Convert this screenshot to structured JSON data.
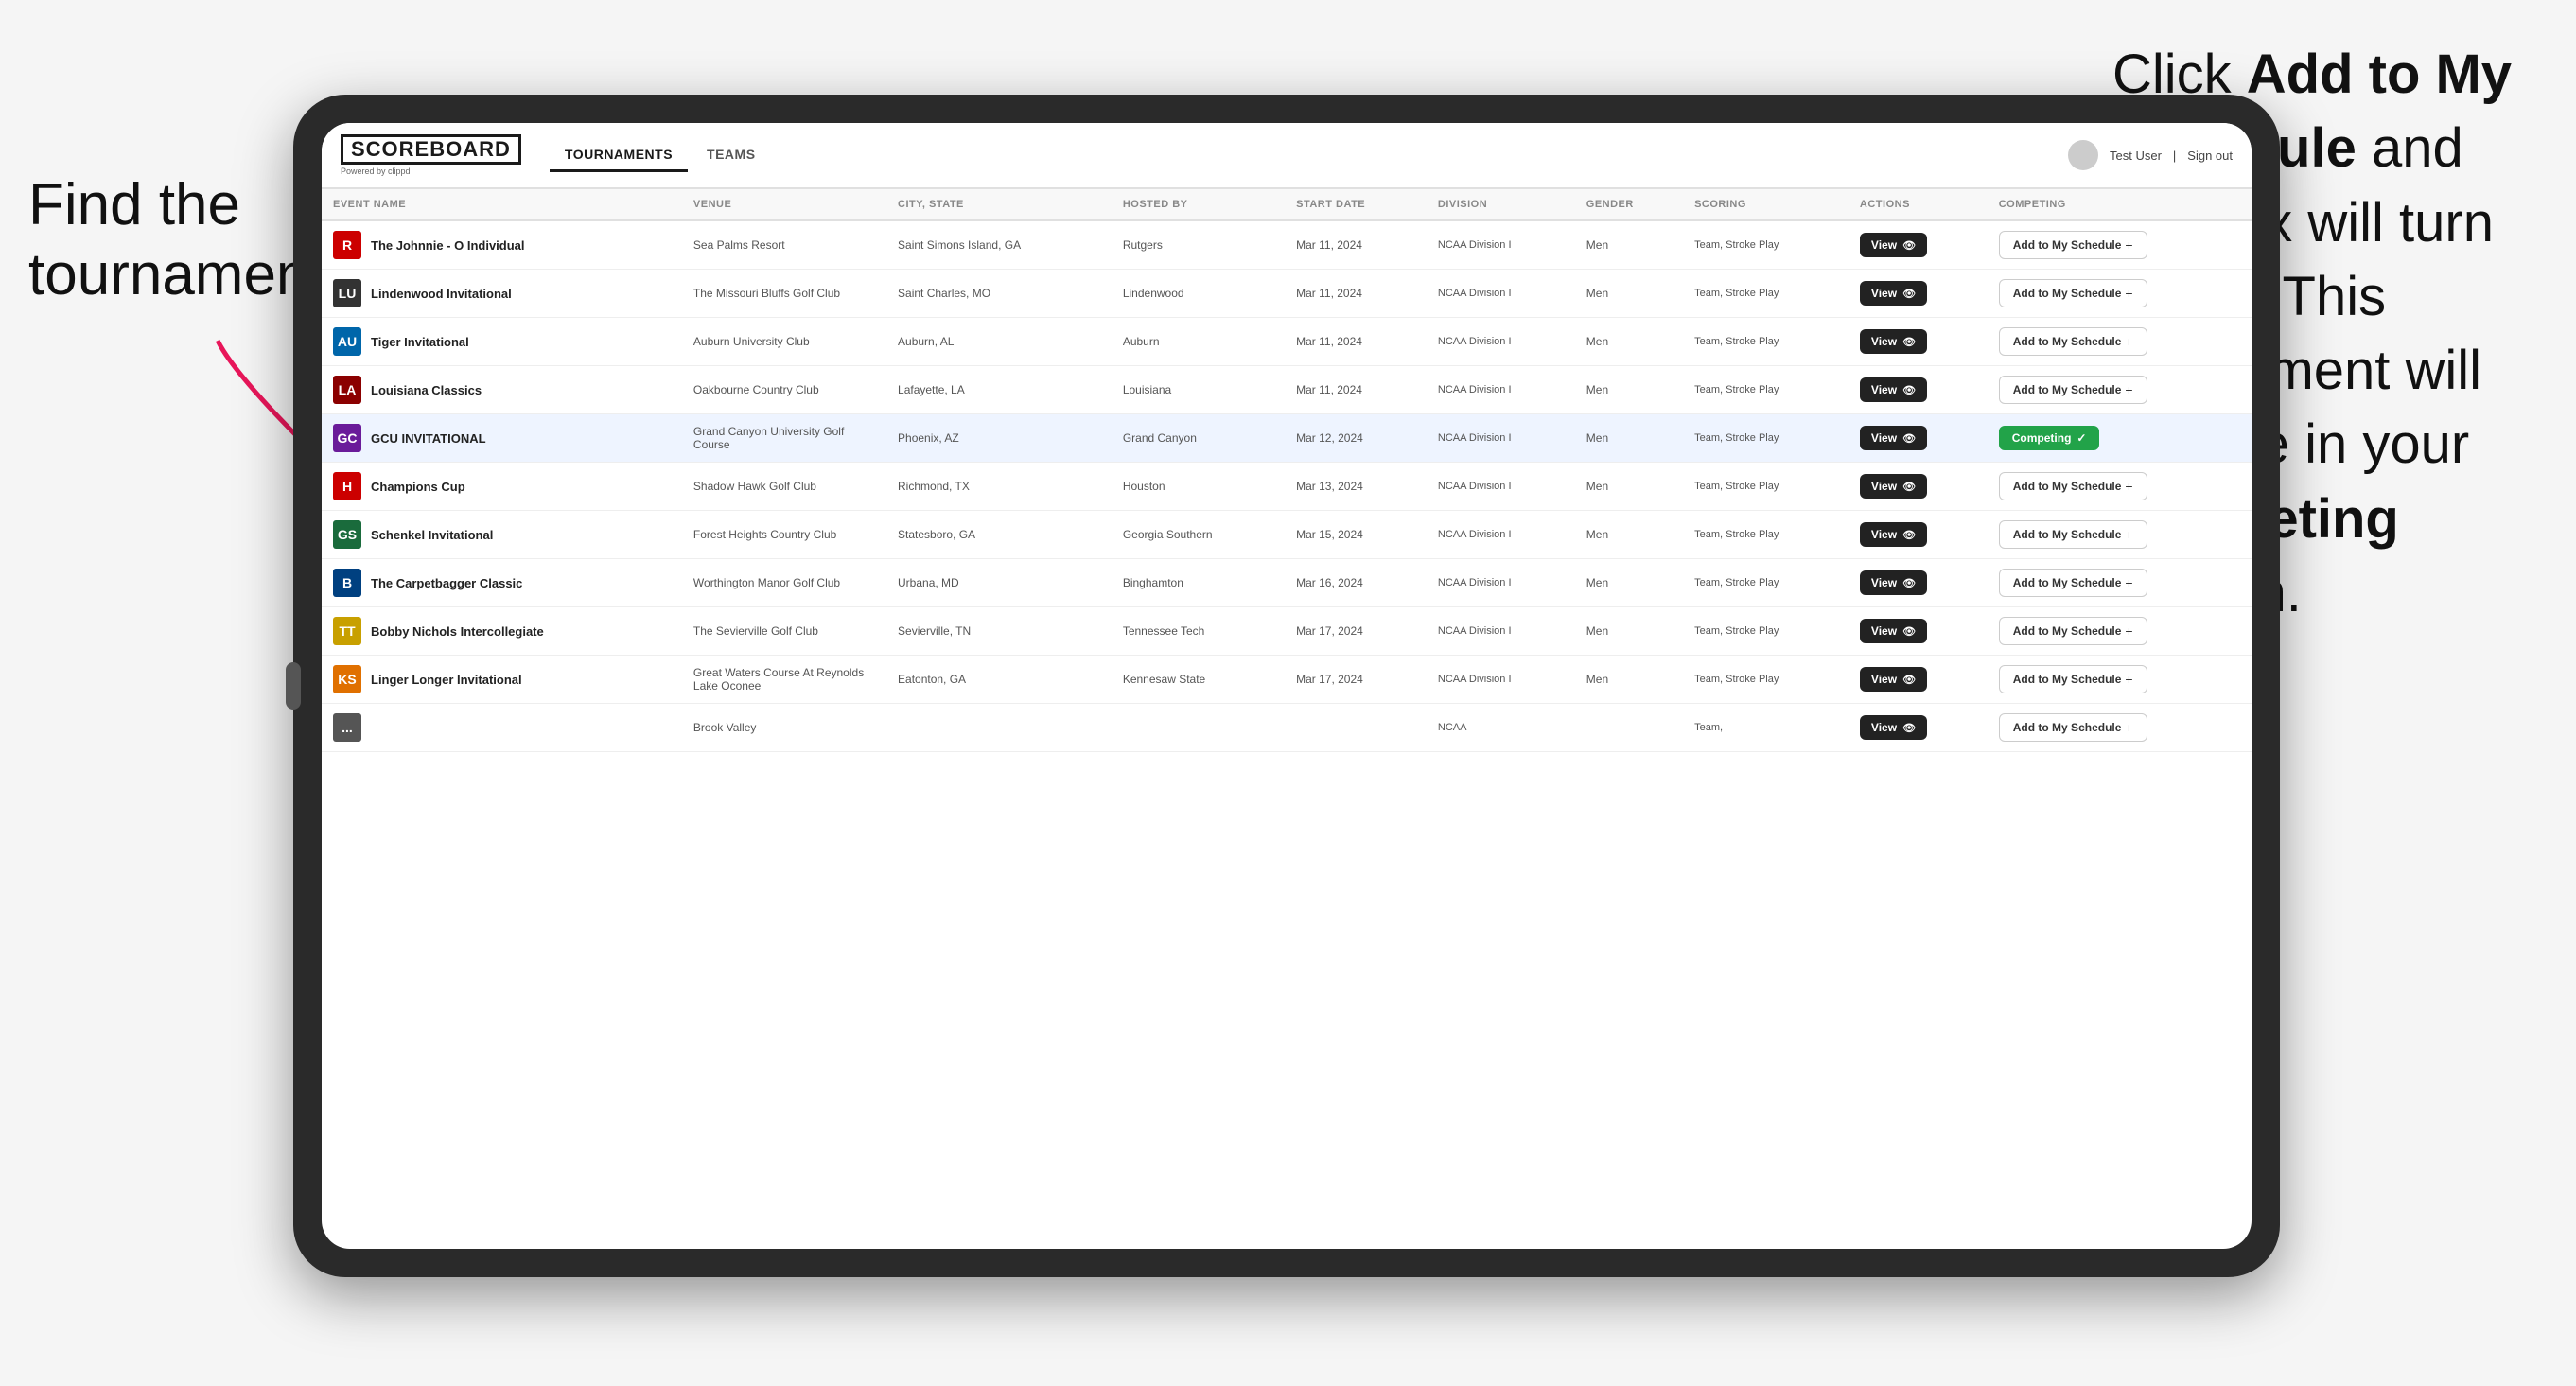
{
  "annotations": {
    "left": {
      "line1": "Find the",
      "line2": "tournament."
    },
    "right": {
      "text_pre": "Click ",
      "bold1": "Add to My Schedule",
      "text_mid": " and the box will turn green. This tournament will now be in your ",
      "bold2": "Competing",
      "text_post": " section."
    }
  },
  "app": {
    "logo": "SCOREBOARD",
    "logo_sub": "Powered by clippd",
    "nav_tabs": [
      "TOURNAMENTS",
      "TEAMS"
    ],
    "active_tab": "TOURNAMENTS",
    "user_label": "Test User",
    "sign_out": "Sign out"
  },
  "table": {
    "columns": [
      "EVENT NAME",
      "VENUE",
      "CITY, STATE",
      "HOSTED BY",
      "START DATE",
      "DIVISION",
      "GENDER",
      "SCORING",
      "ACTIONS",
      "COMPETING"
    ],
    "rows": [
      {
        "id": 1,
        "logo_color": "#cc0000",
        "logo_text": "R",
        "event_name": "The Johnnie - O Individual",
        "venue": "Sea Palms Resort",
        "city_state": "Saint Simons Island, GA",
        "hosted_by": "Rutgers",
        "start_date": "Mar 11, 2024",
        "division": "NCAA Division I",
        "gender": "Men",
        "scoring": "Team, Stroke Play",
        "action": "view",
        "competing": "add",
        "highlighted": false
      },
      {
        "id": 2,
        "logo_color": "#333",
        "logo_text": "LU",
        "event_name": "Lindenwood Invitational",
        "venue": "The Missouri Bluffs Golf Club",
        "city_state": "Saint Charles, MO",
        "hosted_by": "Lindenwood",
        "start_date": "Mar 11, 2024",
        "division": "NCAA Division I",
        "gender": "Men",
        "scoring": "Team, Stroke Play",
        "action": "view",
        "competing": "add",
        "highlighted": false
      },
      {
        "id": 3,
        "logo_color": "#0066aa",
        "logo_text": "AU",
        "event_name": "Tiger Invitational",
        "venue": "Auburn University Club",
        "city_state": "Auburn, AL",
        "hosted_by": "Auburn",
        "start_date": "Mar 11, 2024",
        "division": "NCAA Division I",
        "gender": "Men",
        "scoring": "Team, Stroke Play",
        "action": "view",
        "competing": "add",
        "highlighted": false
      },
      {
        "id": 4,
        "logo_color": "#8b0000",
        "logo_text": "LA",
        "event_name": "Louisiana Classics",
        "venue": "Oakbourne Country Club",
        "city_state": "Lafayette, LA",
        "hosted_by": "Louisiana",
        "start_date": "Mar 11, 2024",
        "division": "NCAA Division I",
        "gender": "Men",
        "scoring": "Team, Stroke Play",
        "action": "view",
        "competing": "add",
        "highlighted": false
      },
      {
        "id": 5,
        "logo_color": "#6a1b9a",
        "logo_text": "GC",
        "event_name": "GCU INVITATIONAL",
        "venue": "Grand Canyon University Golf Course",
        "city_state": "Phoenix, AZ",
        "hosted_by": "Grand Canyon",
        "start_date": "Mar 12, 2024",
        "division": "NCAA Division I",
        "gender": "Men",
        "scoring": "Team, Stroke Play",
        "action": "view",
        "competing": "competing",
        "highlighted": true
      },
      {
        "id": 6,
        "logo_color": "#cc0000",
        "logo_text": "H",
        "event_name": "Champions Cup",
        "venue": "Shadow Hawk Golf Club",
        "city_state": "Richmond, TX",
        "hosted_by": "Houston",
        "start_date": "Mar 13, 2024",
        "division": "NCAA Division I",
        "gender": "Men",
        "scoring": "Team, Stroke Play",
        "action": "view",
        "competing": "add",
        "highlighted": false
      },
      {
        "id": 7,
        "logo_color": "#1a6b3c",
        "logo_text": "GS",
        "event_name": "Schenkel Invitational",
        "venue": "Forest Heights Country Club",
        "city_state": "Statesboro, GA",
        "hosted_by": "Georgia Southern",
        "start_date": "Mar 15, 2024",
        "division": "NCAA Division I",
        "gender": "Men",
        "scoring": "Team, Stroke Play",
        "action": "view",
        "competing": "add",
        "highlighted": false
      },
      {
        "id": 8,
        "logo_color": "#004080",
        "logo_text": "B",
        "event_name": "The Carpetbagger Classic",
        "venue": "Worthington Manor Golf Club",
        "city_state": "Urbana, MD",
        "hosted_by": "Binghamton",
        "start_date": "Mar 16, 2024",
        "division": "NCAA Division I",
        "gender": "Men",
        "scoring": "Team, Stroke Play",
        "action": "view",
        "competing": "add",
        "highlighted": false
      },
      {
        "id": 9,
        "logo_color": "#c8a000",
        "logo_text": "TT",
        "event_name": "Bobby Nichols Intercollegiate",
        "venue": "The Sevierville Golf Club",
        "city_state": "Sevierville, TN",
        "hosted_by": "Tennessee Tech",
        "start_date": "Mar 17, 2024",
        "division": "NCAA Division I",
        "gender": "Men",
        "scoring": "Team, Stroke Play",
        "action": "view",
        "competing": "add",
        "highlighted": false
      },
      {
        "id": 10,
        "logo_color": "#e07000",
        "logo_text": "KS",
        "event_name": "Linger Longer Invitational",
        "venue": "Great Waters Course At Reynolds Lake Oconee",
        "city_state": "Eatonton, GA",
        "hosted_by": "Kennesaw State",
        "start_date": "Mar 17, 2024",
        "division": "NCAA Division I",
        "gender": "Men",
        "scoring": "Team, Stroke Play",
        "action": "view",
        "competing": "add",
        "highlighted": false
      },
      {
        "id": 11,
        "logo_color": "#555",
        "logo_text": "...",
        "event_name": "",
        "venue": "Brook Valley",
        "city_state": "",
        "hosted_by": "",
        "start_date": "",
        "division": "NCAA",
        "gender": "",
        "scoring": "Team,",
        "action": "view",
        "competing": "add",
        "highlighted": false
      }
    ],
    "view_label": "View",
    "add_label": "Add to My Schedule",
    "competing_label": "Competing"
  }
}
